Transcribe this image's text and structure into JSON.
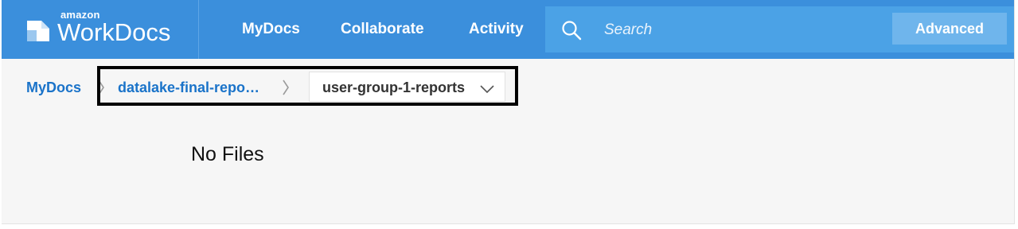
{
  "brand": {
    "small_text": "amazon",
    "name": "WorkDocs",
    "logo_icon": "workdocs-logo-icon"
  },
  "nav": {
    "items": [
      {
        "label": "MyDocs"
      },
      {
        "label": "Collaborate"
      },
      {
        "label": "Activity"
      }
    ]
  },
  "search": {
    "placeholder": "Search",
    "value": "",
    "icon": "search-icon",
    "advanced_label": "Advanced"
  },
  "breadcrumb": {
    "items": [
      {
        "label": "MyDocs"
      },
      {
        "label": "datalake-final-repo…"
      }
    ],
    "current": "user-group-1-reports",
    "separator_icon": "chevron-right-icon",
    "dropdown_icon": "chevron-down-icon"
  },
  "content": {
    "empty_message": "No Files"
  },
  "colors": {
    "nav_bg": "#3b8fdc",
    "search_bg": "#4ba2e6",
    "advanced_bg": "#6fb5ec",
    "link": "#1a73c9",
    "page_bg": "#f6f6f6",
    "highlight_border": "#000000"
  }
}
